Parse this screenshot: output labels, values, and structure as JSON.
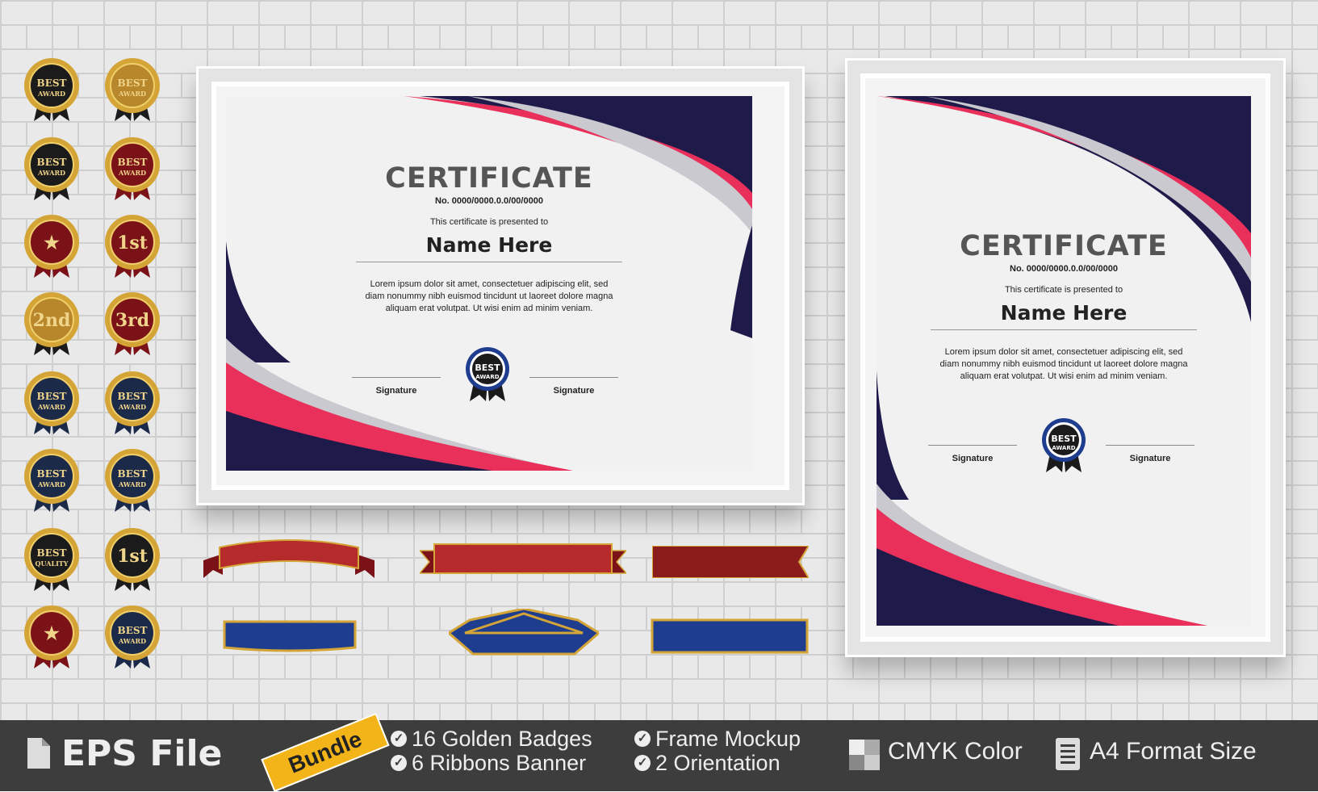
{
  "certificates": [
    {
      "title": "CERTIFICATE",
      "number": "No. 0000/0000.0.0/00/0000",
      "presented": "This certificate is presented to",
      "name": "Name Here",
      "lorem_1": "Lorem ipsum dolor sit amet, consectetuer adipiscing elit, sed",
      "lorem_2": "diam nonummy nibh euismod tincidunt ut laoreet dolore magna",
      "lorem_3": "aliquam erat volutpat. Ut wisi enim ad minim veniam.",
      "signature_left": "Signature",
      "signature_right": "Signature",
      "seal_line1": "BEST",
      "seal_line2": "AWARD"
    },
    {
      "title": "CERTIFICATE",
      "number": "No. 0000/0000.0.0/00/0000",
      "presented": "This certificate is presented to",
      "name": "Name Here",
      "lorem_1": "Lorem ipsum dolor sit amet, consectetuer adipiscing elit, sed",
      "lorem_2": "diam nonummy nibh euismod tincidunt ut laoreet dolore magna",
      "lorem_3": "aliquam erat volutpat. Ut wisi enim ad minim veniam.",
      "signature_left": "Signature",
      "signature_right": "Signature",
      "seal_line1": "BEST",
      "seal_line2": "AWARD"
    }
  ],
  "badges": [
    {
      "line1": "BEST",
      "line2": "AWARD",
      "style": "dark"
    },
    {
      "line1": "BEST",
      "line2": "AWARD",
      "style": "gold"
    },
    {
      "line1": "BEST",
      "line2": "AWARD",
      "style": "dark"
    },
    {
      "line1": "BEST",
      "line2": "AWARD",
      "style": "red"
    },
    {
      "line1": "★",
      "line2": "",
      "style": "red"
    },
    {
      "line1": "1st",
      "line2": "",
      "style": "red"
    },
    {
      "line1": "2nd",
      "line2": "",
      "style": "gold"
    },
    {
      "line1": "3rd",
      "line2": "",
      "style": "red"
    },
    {
      "line1": "BEST",
      "line2": "AWARD",
      "style": "navy"
    },
    {
      "line1": "BEST",
      "line2": "AWARD",
      "style": "navy"
    },
    {
      "line1": "BEST",
      "line2": "AWARD",
      "style": "navy"
    },
    {
      "line1": "BEST",
      "line2": "AWARD",
      "style": "navy"
    },
    {
      "line1": "BEST",
      "line2": "QUALITY",
      "style": "dark"
    },
    {
      "line1": "1st",
      "line2": "",
      "style": "dark"
    },
    {
      "line1": "★",
      "line2": "",
      "style": "red"
    },
    {
      "line1": "BEST",
      "line2": "AWARD",
      "style": "navy"
    }
  ],
  "footer": {
    "file_label": "EPS File",
    "bundle_label": "Bundle",
    "feature_1": "16 Golden Badges",
    "feature_2": "6  Ribbons Banner",
    "feature_3": "Frame Mockup",
    "feature_4": "2 Orientation",
    "cmyk_label": "CMYK Color",
    "format_label": "A4 Format Size",
    "icons": [
      "file-icon",
      "check-icon",
      "color-swatch-icon",
      "document-icon"
    ]
  },
  "colors": {
    "navy": "#1e1a4a",
    "pink": "#e8305a",
    "gold": "#d4a536",
    "dark_red": "#7a1218",
    "footer_bg": "#3d3d3d",
    "bundle_yellow": "#f2b418"
  }
}
